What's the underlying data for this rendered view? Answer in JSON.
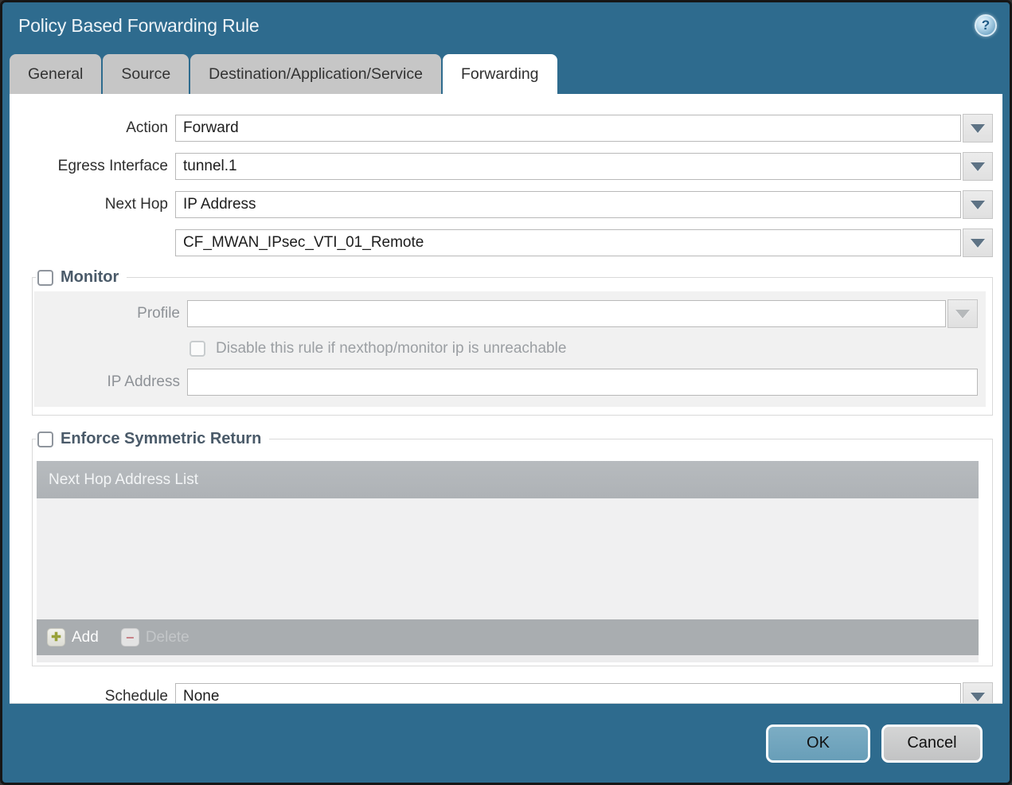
{
  "dialog": {
    "title": "Policy Based Forwarding Rule",
    "help_glyph": "?"
  },
  "tabs": [
    {
      "label": "General",
      "active": false
    },
    {
      "label": "Source",
      "active": false
    },
    {
      "label": "Destination/Application/Service",
      "active": false
    },
    {
      "label": "Forwarding",
      "active": true
    }
  ],
  "form": {
    "action": {
      "label": "Action",
      "value": "Forward"
    },
    "egress_interface": {
      "label": "Egress Interface",
      "value": "tunnel.1"
    },
    "next_hop": {
      "label": "Next Hop",
      "value": "IP Address"
    },
    "next_hop_address": {
      "value": "CF_MWAN_IPsec_VTI_01_Remote"
    },
    "schedule": {
      "label": "Schedule",
      "value": "None"
    }
  },
  "monitor": {
    "legend": "Monitor",
    "checked": false,
    "profile": {
      "label": "Profile",
      "value": "",
      "placeholder": ""
    },
    "disable_rule": {
      "label": "Disable this rule if nexthop/monitor ip is unreachable",
      "checked": false
    },
    "ip_address": {
      "label": "IP Address",
      "value": "",
      "placeholder": ""
    }
  },
  "symmetric_return": {
    "legend": "Enforce Symmetric Return",
    "checked": false,
    "table": {
      "header": "Next Hop Address List",
      "rows": []
    },
    "add_label": "Add",
    "delete_label": "Delete",
    "delete_enabled": false
  },
  "footer": {
    "ok_label": "OK",
    "cancel_label": "Cancel"
  },
  "colors": {
    "titlebar_teal": "#2e6b8e",
    "active_tab": "#ffffff",
    "inactive_tab": "#c6c6c6",
    "panel_gray": "#f1f1f1",
    "profile_field_beige": "#f6efdc",
    "table_header_gray": "#b2b6b9",
    "table_footer_gray": "#a9adb0",
    "ok_button_blue": "#6fa5bd",
    "cancel_button_gray": "#c9caca",
    "legend_text": "#4a5a69",
    "add_plus_green": "#98a139",
    "delete_minus_red": "#c78086"
  }
}
